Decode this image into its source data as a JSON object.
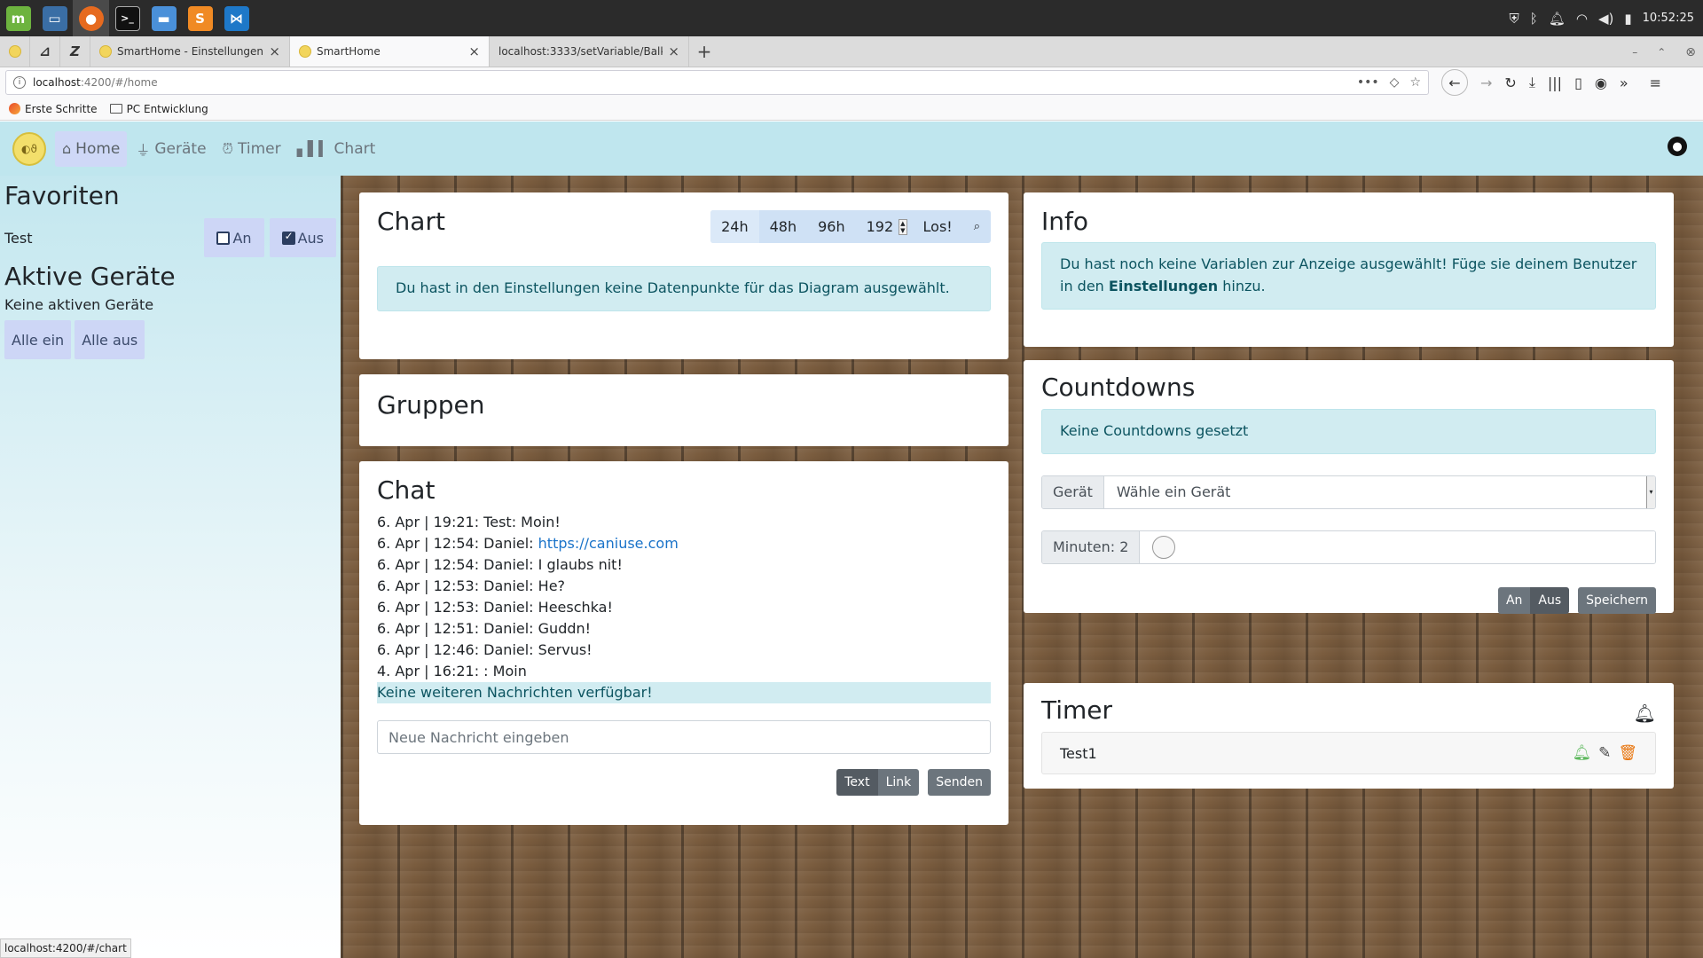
{
  "taskbar": {
    "apps": [
      {
        "name": "linuxmint-menu-icon",
        "glyph": "m",
        "color": "#6db33f"
      },
      {
        "name": "show-desktop-icon",
        "glyph": "▭",
        "color": "#3a6ea5"
      },
      {
        "name": "firefox-icon",
        "glyph": "●",
        "color": "#e66a1f"
      },
      {
        "name": "terminal-icon",
        "glyph": ">_",
        "color": "#1b1b1b"
      },
      {
        "name": "files-icon",
        "glyph": "▬",
        "color": "#4a90d9"
      },
      {
        "name": "sublime-icon",
        "glyph": "S",
        "color": "#f08a24"
      },
      {
        "name": "vscode-icon",
        "glyph": "⋈",
        "color": "#1e78c8"
      }
    ],
    "clock": "10:52:25"
  },
  "browser": {
    "tabs": [
      {
        "title": "SmartHome - Einstellungen",
        "active": false
      },
      {
        "title": "SmartHome",
        "active": true
      },
      {
        "title": "localhost:3333/setVariable/Balkon",
        "active": false
      }
    ],
    "url_host": "localhost",
    "url_path": ":4200/#/home",
    "bookmarks": [
      "Erste Schritte",
      "PC Entwicklung"
    ],
    "status_url": "localhost:4200/#/chart"
  },
  "nav": {
    "items": [
      {
        "label": "Home",
        "icon": "home-icon",
        "active": true
      },
      {
        "label": "Geräte",
        "icon": "plug-icon",
        "active": false
      },
      {
        "label": "Timer",
        "icon": "alarm-clock-icon",
        "active": false
      },
      {
        "label": "Chart",
        "icon": "bar-chart-icon",
        "active": false
      }
    ]
  },
  "sidebar": {
    "favorites_title": "Favoriten",
    "favorite": {
      "label": "Test",
      "on_label": "An",
      "off_label": "Aus",
      "on_checked": false,
      "off_checked": true
    },
    "active_title": "Aktive Geräte",
    "no_active": "Keine aktiven Geräte",
    "all_on": "Alle ein",
    "all_off": "Alle aus"
  },
  "chart_card": {
    "title": "Chart",
    "ranges": [
      "24h",
      "48h",
      "96h"
    ],
    "custom_hours": "192",
    "go_label": "Los!",
    "message": "Du hast in den Einstellungen keine Datenpunkte für das Diagram ausgewählt."
  },
  "groups_card": {
    "title": "Gruppen"
  },
  "chat_card": {
    "title": "Chat",
    "messages": [
      "6. Apr | 19:21: Test: Moin!",
      "6. Apr | 12:54: Daniel: ",
      "6. Apr | 12:54: Daniel: I glaubs nit!",
      "6. Apr | 12:53: Daniel: He?",
      "6. Apr | 12:53: Daniel: Heeschka!",
      "6. Apr | 12:51: Daniel: Guddn!",
      "6. Apr | 12:46: Daniel: Servus!",
      "4. Apr | 16:21: : Moin"
    ],
    "link_text": "https://caniuse.com",
    "no_more": "Keine weiteren Nachrichten verfügbar!",
    "placeholder": "Neue Nachricht eingeben",
    "text_label": "Text",
    "link_label": "Link",
    "send_label": "Senden"
  },
  "info_card": {
    "title": "Info",
    "message_pre": "Du hast noch keine Variablen zur Anzeige ausgewählt! Füge sie deinem Benutzer in den ",
    "message_bold": "Einstellungen",
    "message_post": " hinzu."
  },
  "countdown_card": {
    "title": "Countdowns",
    "none": "Keine Countdowns gesetzt",
    "device_label": "Gerät",
    "device_value": "Wähle ein Gerät",
    "minutes_label": "Minuten: 2",
    "on_label": "An",
    "off_label": "Aus",
    "save_label": "Speichern"
  },
  "timer_card": {
    "title": "Timer",
    "items": [
      {
        "name": "Test1"
      }
    ]
  }
}
